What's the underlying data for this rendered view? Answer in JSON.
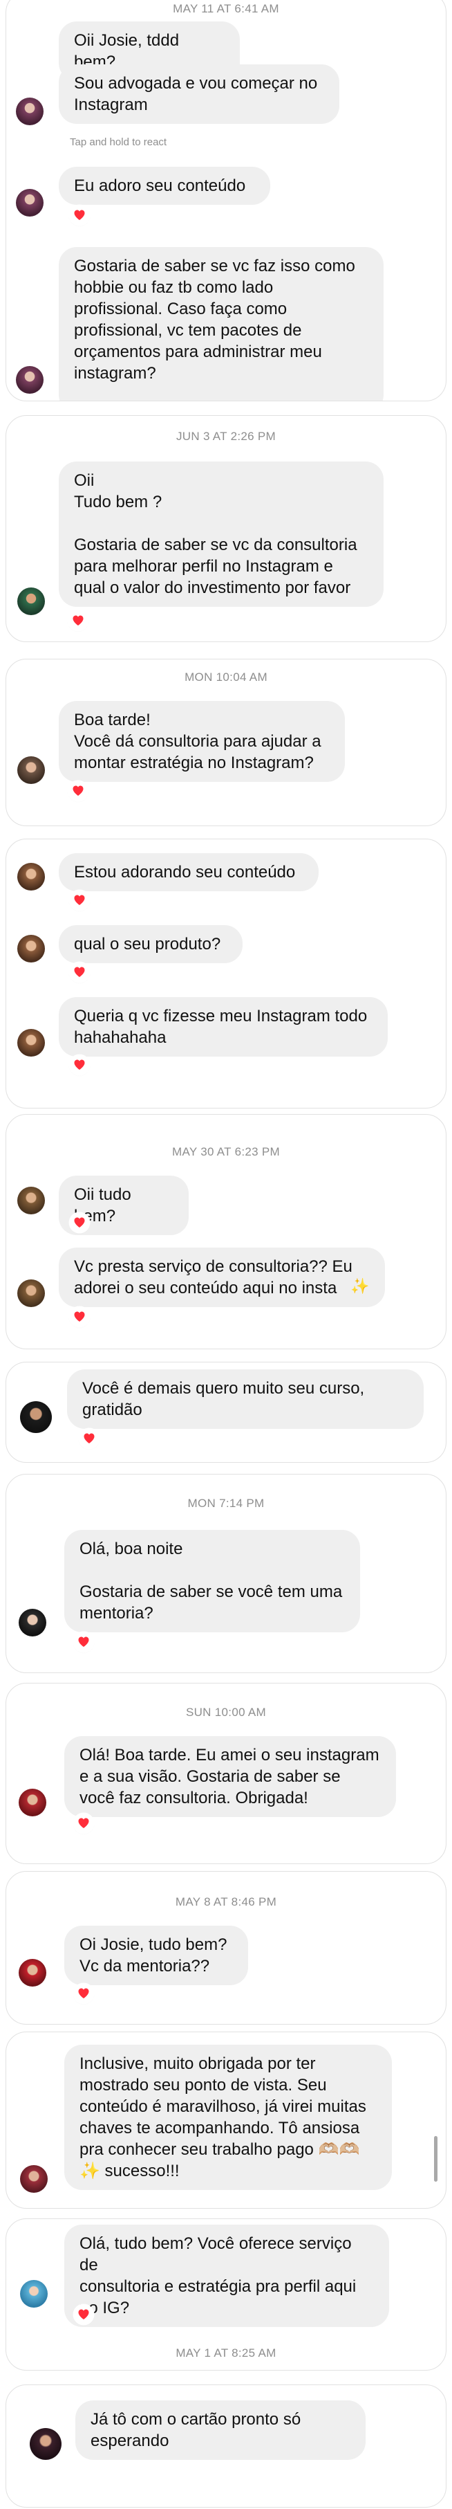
{
  "colors": {
    "bubble_bg": "#efefef",
    "heart": "#ff2d3a",
    "timestamp": "#8e8e8e",
    "card_border": "#e1e1e1"
  },
  "threads": [
    {
      "timestamp": "MAY 11 AT 6:41 AM",
      "messages": [
        {
          "text": "Oii Josie, tddd bem?"
        },
        {
          "text": "Sou advogada e vou começar no\nInstagram",
          "hint": "Tap and hold to react"
        },
        {
          "text": "Eu adoro seu conteúdo",
          "reaction": "red-heart"
        },
        {
          "text": "Gostaria de saber se vc faz isso como\nhobbie ou faz tb como lado\nprofissional. Caso faça como\nprofissional, vc tem pacotes de\norçamentos para administrar meu\ninstagram?"
        }
      ]
    },
    {
      "timestamp": "JUN 3 AT 2:26 PM",
      "messages": [
        {
          "text": "Oii\nTudo bem ?\n\nGostaria de saber se vc da consultoria\npara melhorar perfil no Instagram e\nqual o valor do investimento por favor",
          "reaction": "red-heart"
        }
      ]
    },
    {
      "timestamp": "MON 10:04 AM",
      "messages": [
        {
          "text": "Boa tarde!\nVocê dá consultoria para ajudar a\nmontar estratégia no Instagram?",
          "reaction": "red-heart"
        }
      ]
    },
    {
      "timestamp": "",
      "messages": [
        {
          "text": "Estou adorando seu conteúdo",
          "reaction": "red-heart"
        },
        {
          "text": "qual o seu produto?",
          "reaction": "red-heart"
        },
        {
          "text": "Queria q vc fizesse meu Instagram todo\nhahahahaha",
          "reaction": "red-heart"
        }
      ]
    },
    {
      "timestamp": "MAY 30 AT 6:23 PM",
      "messages": [
        {
          "text": "Oii tudo bem?",
          "reaction": "red-heart"
        },
        {
          "text": "Vc presta serviço de consultoria?? Eu\nadorei o seu conteúdo aqui no insta",
          "emoji": "✨",
          "reaction": "red-heart"
        }
      ]
    },
    {
      "timestamp": "",
      "messages": [
        {
          "text": "Você é demais quero muito seu curso,\ngratidão",
          "reaction": "red-heart"
        }
      ]
    },
    {
      "timestamp": "MON 7:14 PM",
      "messages": [
        {
          "text": "Olá, boa noite\n\nGostaria de saber se você tem uma\nmentoria?",
          "reaction": "red-heart"
        }
      ]
    },
    {
      "timestamp": "SUN 10:00 AM",
      "messages": [
        {
          "text": "Olá! Boa tarde. Eu amei o seu instagram\ne a sua visão. Gostaria de saber se\nvocê faz consultoria. Obrigada!",
          "reaction": "red-heart"
        }
      ]
    },
    {
      "timestamp": "MAY 8 AT 8:46 PM",
      "messages": [
        {
          "text": "Oi Josie, tudo bem?\nVc da mentoria??",
          "reaction": "red-heart"
        }
      ]
    },
    {
      "timestamp": "",
      "messages": [
        {
          "text": "Inclusive, muito obrigada por ter\nmostrado seu ponto de vista. Seu\nconteúdo é maravilhoso, já virei muitas\nchaves te acompanhando. Tô ansiosa\npra conhecer seu trabalho pago 🫶🏼🫶🏼\n✨ sucesso!!!"
        }
      ]
    },
    {
      "timestamp": "MAY 1 AT 8:25 AM",
      "messages": [
        {
          "text": "Olá, tudo bem? Você oferece serviço de\nconsultoria e estratégia pra perfil aqui\nno IG?",
          "reaction": "red-heart"
        }
      ]
    },
    {
      "timestamp": "",
      "messages": [
        {
          "text": "Já tô com o cartão pronto só\nesperando"
        }
      ]
    }
  ]
}
